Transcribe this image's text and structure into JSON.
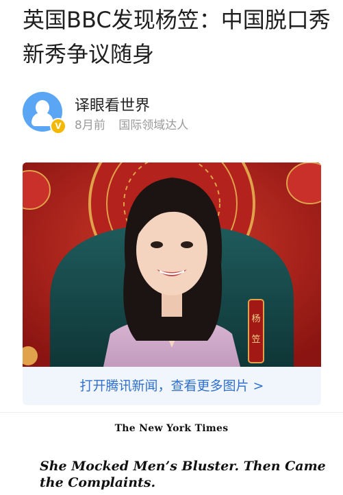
{
  "article": {
    "title": "英国BBC发现杨笠：中国脱口秀新秀争议随身"
  },
  "author": {
    "name": "译眼看世界",
    "time": "8月前",
    "tag": "国际领域达人",
    "avatar_icon": "user-avatar-icon",
    "badge_label": "V"
  },
  "photo": {
    "name_plate": [
      "杨",
      "笠"
    ]
  },
  "cta": {
    "label": "打开腾讯新闻，查看更多图片 >"
  },
  "clipping": {
    "masthead": "The New York Times",
    "headline": "She Mocked Men’s Bluster. Then Came the Complaints."
  },
  "colors": {
    "accent": "#2f6fd0",
    "cta_bg": "#f1f6fd",
    "avatar": "#5aa6f5",
    "badge": "#f5b800",
    "photo_red": "#a81e1a"
  }
}
